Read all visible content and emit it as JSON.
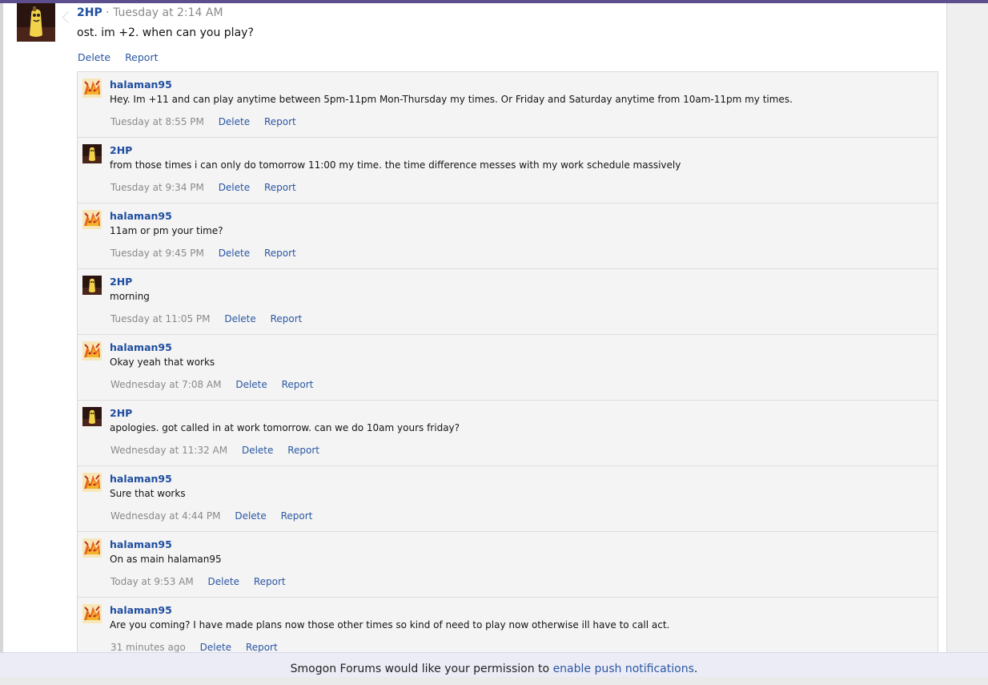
{
  "main_post": {
    "username": "2HP",
    "separator": "·",
    "time": "Tuesday at 2:14 AM",
    "text": "ost. im +2. when can you play?",
    "delete_label": "Delete",
    "report_label": "Report",
    "avatar_icon": "banana-character-avatar-icon"
  },
  "comments": [
    {
      "username": "halaman95",
      "text": "Hey. Im +11 and can play anytime between 5pm-11pm Mon-Thursday my times. Or Friday and Saturday anytime from 10am-11pm my times.",
      "time": "Tuesday at 8:55 PM",
      "delete_label": "Delete",
      "report_label": "Report"
    },
    {
      "username": "2HP",
      "text": "from those times i can only do tomorrow 11:00 my time. the time difference messes with my work schedule massively",
      "time": "Tuesday at 9:34 PM",
      "delete_label": "Delete",
      "report_label": "Report"
    },
    {
      "username": "halaman95",
      "text": "11am or pm your time?",
      "time": "Tuesday at 9:45 PM",
      "delete_label": "Delete",
      "report_label": "Report"
    },
    {
      "username": "2HP",
      "text": "morning",
      "time": "Tuesday at 11:05 PM",
      "delete_label": "Delete",
      "report_label": "Report"
    },
    {
      "username": "halaman95",
      "text": "Okay yeah that works",
      "time": "Wednesday at 7:08 AM",
      "delete_label": "Delete",
      "report_label": "Report"
    },
    {
      "username": "2HP",
      "text": "apologies. got called in at work tomorrow. can we do 10am yours friday?",
      "time": "Wednesday at 11:32 AM",
      "delete_label": "Delete",
      "report_label": "Report"
    },
    {
      "username": "halaman95",
      "text": "Sure that works",
      "time": "Wednesday at 4:44 PM",
      "delete_label": "Delete",
      "report_label": "Report"
    },
    {
      "username": "halaman95",
      "text": "On as main halaman95",
      "time": "Today at 9:53 AM",
      "delete_label": "Delete",
      "report_label": "Report"
    },
    {
      "username": "halaman95",
      "text": "Are you coming? I have made plans now those other times so kind of need to play now otherwise ill have to call act.",
      "time": "31 minutes ago",
      "delete_label": "Delete",
      "report_label": "Report"
    }
  ],
  "push_notice": {
    "text": "Smogon Forums would like your permission to ",
    "link": "enable push notifications",
    "suffix": "."
  },
  "colors": {
    "link": "#2b57a3",
    "username": "#1f4ea0",
    "meta": "#8a8a8a",
    "top_bar": "#5d4f8d"
  }
}
